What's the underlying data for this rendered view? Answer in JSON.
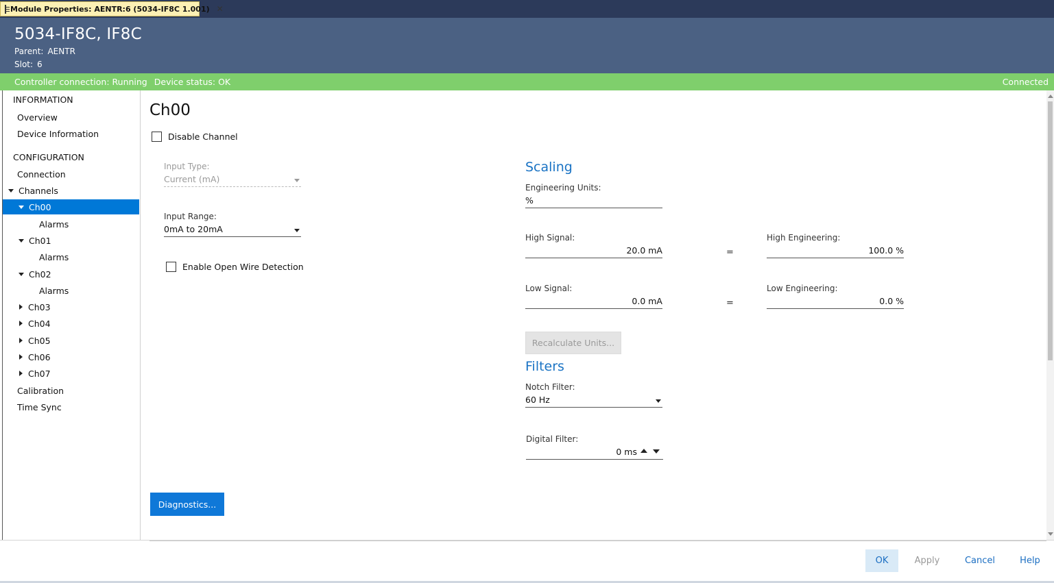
{
  "tab": {
    "label": "Module Properties:  AENTR:6 (5034-IF8C 1.001)",
    "close": "✕"
  },
  "header": {
    "title": "5034-IF8C, IF8C",
    "parent_label": "Parent:",
    "parent_value": "AENTR",
    "slot_label": "Slot:",
    "slot_value": "6"
  },
  "status": {
    "controller": "Controller connection: Running",
    "device": "Device status: OK",
    "connection": "Connected"
  },
  "sidebar": {
    "information": "INFORMATION",
    "overview": "Overview",
    "device_information": "Device Information",
    "configuration": "CONFIGURATION",
    "connection": "Connection",
    "channels": "Channels",
    "ch00": "Ch00",
    "ch00_alarms": "Alarms",
    "ch01": "Ch01",
    "ch01_alarms": "Alarms",
    "ch02": "Ch02",
    "ch02_alarms": "Alarms",
    "ch03": "Ch03",
    "ch04": "Ch04",
    "ch05": "Ch05",
    "ch06": "Ch06",
    "ch07": "Ch07",
    "calibration": "Calibration",
    "time_sync": "Time Sync"
  },
  "main": {
    "title": "Ch00",
    "disable_channel": "Disable Channel",
    "input_type_label": "Input Type:",
    "input_type_value": "Current (mA)",
    "input_range_label": "Input Range:",
    "input_range_value": "0mA to 20mA",
    "open_wire": "Enable Open Wire Detection",
    "scaling_heading": "Scaling",
    "eng_units_label": "Engineering Units:",
    "eng_units_value": "%",
    "high_signal_label": "High Signal:",
    "high_signal_value": "20.0 mA",
    "high_eng_label": "High Engineering:",
    "high_eng_value": "100.0 %",
    "low_signal_label": "Low Signal:",
    "low_signal_value": "0.0 mA",
    "low_eng_label": "Low Engineering:",
    "low_eng_value": "0.0 %",
    "equals": "=",
    "recalc_button": "Recalculate Units...",
    "filters_heading": "Filters",
    "notch_label": "Notch Filter:",
    "notch_value": "60 Hz",
    "digital_label": "Digital Filter:",
    "digital_value": "0 ms",
    "diagnostics_button": "Diagnostics..."
  },
  "footer": {
    "ok": "OK",
    "apply": "Apply",
    "cancel": "Cancel",
    "help": "Help"
  },
  "colors": {
    "header_bg": "#4b6183",
    "status_bg": "#7fcf6c",
    "accent": "#0078d7",
    "heading": "#1a73c4",
    "tab_bg": "#fcf0b4"
  }
}
